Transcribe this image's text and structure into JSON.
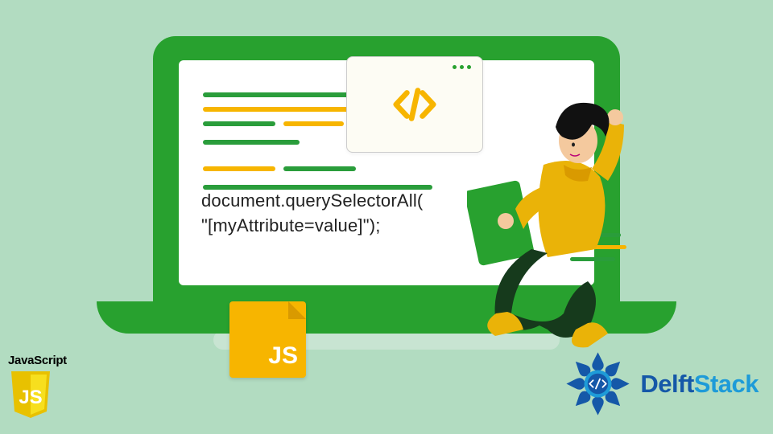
{
  "snippet": {
    "line1": "document.querySelectorAll(",
    "line2": "\"[myAttribute=value]\");"
  },
  "js_file_label": "JS",
  "js_corner_word": "JavaScript",
  "delftstack": {
    "part1": "Delft",
    "part2": "Stack"
  },
  "colors": {
    "bg": "#b2dcc1",
    "green": "#28a12f",
    "yellow": "#f7b500",
    "delft_blue": "#1558a8",
    "delft_cyan": "#1e9bd8"
  }
}
